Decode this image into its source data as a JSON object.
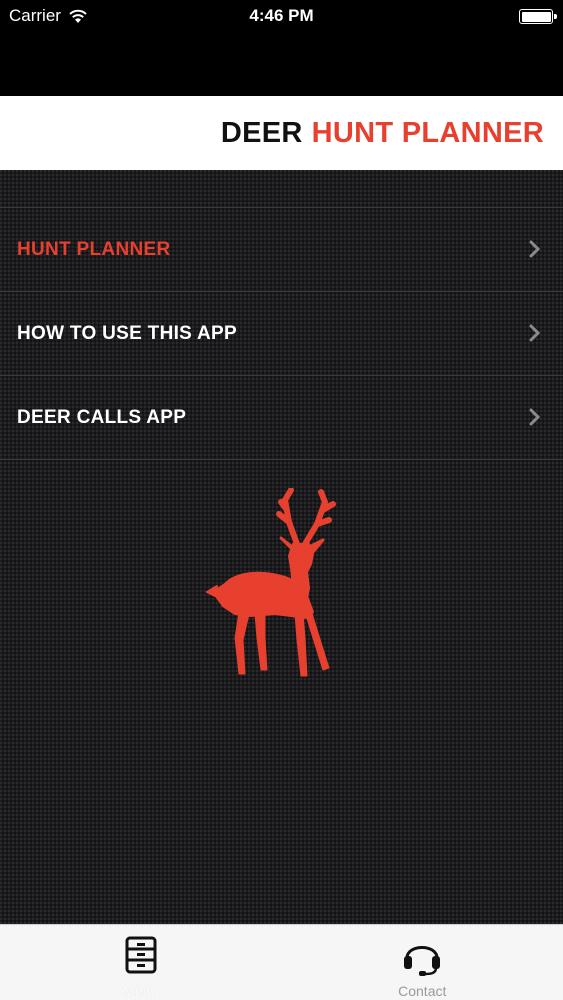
{
  "status_bar": {
    "carrier": "Carrier",
    "time": "4:46 PM",
    "battery_level": 1.0
  },
  "header": {
    "title_dark": "DEER",
    "title_red": "HUNT PLANNER"
  },
  "menu": {
    "items": [
      {
        "label": "HUNT PLANNER",
        "active": true,
        "icon": "chevron-right-icon"
      },
      {
        "label": "HOW TO USE THIS APP",
        "active": false,
        "icon": "chevron-right-icon"
      },
      {
        "label": "DEER CALLS APP",
        "active": false,
        "icon": "chevron-right-icon"
      }
    ]
  },
  "logo": {
    "icon": "deer-silhouette-icon",
    "color": "#e8402f"
  },
  "tab_bar": {
    "tabs": [
      {
        "label": "Menu",
        "icon": "file-cabinet-icon",
        "active": true
      },
      {
        "label": "Contact",
        "icon": "headset-icon",
        "active": false
      }
    ]
  },
  "colors": {
    "accent": "#e8402f",
    "background": "#1b1b1d",
    "header_bg": "#ffffff",
    "tab_bar_bg": "#f6f6f7"
  }
}
